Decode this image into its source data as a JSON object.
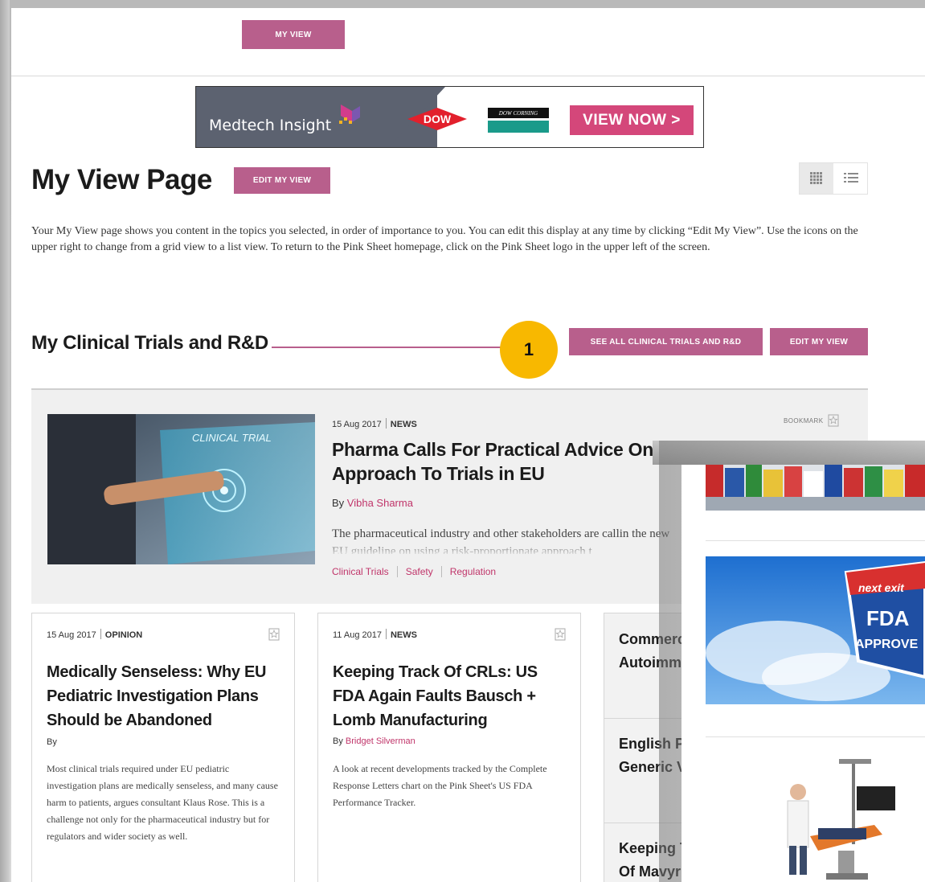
{
  "nav": {
    "my_view": "MY VIEW"
  },
  "ad": {
    "brand": "Medtech Insight",
    "partner1": "DOW",
    "partner2": "DOW CORNING",
    "cta": "VIEW NOW >"
  },
  "header": {
    "title": "My View Page",
    "edit_label": "EDIT MY VIEW"
  },
  "intro": "Your My View page shows you content in the topics you selected, in order of importance to you. You can edit this display at any time by clicking “Edit My View”. Use the icons on the upper right to change from a grid view to a list view. To return to the Pink Sheet homepage, click on the Pink Sheet logo in the upper left of the screen.",
  "section": {
    "title": "My Clinical Trials and R&D",
    "badge": "1",
    "see_all": "SEE ALL CLINICAL TRIALS AND R&D",
    "edit": "EDIT MY VIEW"
  },
  "featured": {
    "date": "15 Aug 2017",
    "type": "NEWS",
    "bookmark": "BOOKMARK",
    "title": "Pharma Calls For Practical Advice On Using Risk-Based Approach To Trials in EU",
    "by": "By",
    "author": "Vibha Sharma",
    "body": "The pharmaceutical industry and other stakeholders are callin the new EU guideline on using a risk-proportionate approach t",
    "image_text": "CLINICAL TRIAL",
    "tags": [
      "Clinical Trials",
      "Safety",
      "Regulation"
    ]
  },
  "cards": [
    {
      "date": "15 Aug 2017",
      "type": "OPINION",
      "title": "Medically Senseless: Why EU Pediatric Investigation Plans Should be Abandoned",
      "by": "By",
      "author": "",
      "body": "Most clinical trials required under EU pediatric investigation plans are medically senseless, and many cause harm to patients, argues consultant Klaus Rose. This is a challenge not only for the pharmaceutical industry but for regulators and wider society as well."
    },
    {
      "date": "11 Aug 2017",
      "type": "NEWS",
      "title": "Keeping Track Of CRLs: US FDA Again Faults Bausch + Lomb Manufacturing",
      "by": "By",
      "author": "Bridget Silverman",
      "body": "A look at recent developments tracked by the Complete Response Letters chart on the Pink Sheet's US FDA Performance Tracker."
    }
  ],
  "card3_items": [
    {
      "line1": "Commerc",
      "line2": "Autoimm"
    },
    {
      "line1": "English P",
      "line2": "Generic V"
    },
    {
      "line1": "Keeping T",
      "line2": "Of Mavyr"
    }
  ],
  "overlay": {
    "fda_sign": [
      "next exit",
      "FDA",
      "APPROVE"
    ]
  },
  "colors": {
    "accent": "#b85f8c",
    "link": "#c0356a",
    "badge": "#f8b800",
    "ad_cta": "#d4477a"
  }
}
